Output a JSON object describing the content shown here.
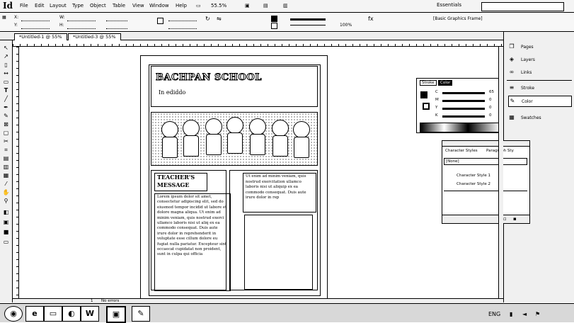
{
  "app": {
    "logo": "Id"
  },
  "menu": {
    "items": [
      "File",
      "Edit",
      "Layout",
      "Type",
      "Object",
      "Table",
      "View",
      "Window",
      "Help"
    ],
    "zoom": "55.5%",
    "workspace": "Essentials"
  },
  "control": {
    "frame_style": "[Basic Graphics Frame]",
    "scale": "100%",
    "x_label": "X:",
    "y_label": "Y:",
    "w_label": "W:",
    "h_label": "H:"
  },
  "tabs": [
    {
      "label": "*Untitled-1 @ 55%"
    },
    {
      "label": "*Untitled-3 @ 55%"
    }
  ],
  "document": {
    "school_title": "BACHPAN SCHOOL",
    "school_subtitle": "In ediddo",
    "teacher_title": "TEACHER'S MESSAGE",
    "teacher_text": "Lorem ipsum dolor sit amet, consectetur adipiscing elit, sed do eiusmod tempor incidid ut labore et dolore magna aliqua. Ut enim ad minim veniam, quis nostrud exerci ullamco laboris nisi ut aliq ex ea commodo consequat. Duis aute irure dolor in reprehenderit in voluptate esse cillum dolore eu fugiat nulla pariatur. Excepteur sint occaecat cupidatat non proident, sunt in culpa qui officia",
    "right_text": "Ut enim ad minim veniam, quis nostrud exercitation ullamco laboris nisi ut aliquip ex ea commodo consequat. Duis aute irure dolor in rep"
  },
  "panels": {
    "items": [
      {
        "label": "Pages",
        "icon": "pages-icon",
        "glyph": "❐"
      },
      {
        "label": "Layers",
        "icon": "layers-icon",
        "glyph": "◈"
      },
      {
        "label": "Links",
        "icon": "links-icon",
        "glyph": "∞"
      },
      {
        "label": "Stroke",
        "icon": "stroke-icon",
        "glyph": "≡"
      },
      {
        "label": "Color",
        "icon": "color-icon",
        "glyph": "✎"
      },
      {
        "label": "Swatches",
        "icon": "swatches-icon",
        "glyph": "▦"
      }
    ],
    "color_panel": {
      "tabs": [
        "Stroke",
        "Color"
      ],
      "rows": [
        {
          "label": "C",
          "value": "65"
        },
        {
          "label": "M",
          "value": "0"
        },
        {
          "label": "Y",
          "value": "0"
        },
        {
          "label": "K",
          "value": "0"
        }
      ]
    },
    "char_panel": {
      "tabs": [
        "Character Styles",
        "Paragraph Sty"
      ],
      "items": [
        "[None]",
        "Character Style 1",
        "Character Style 2"
      ]
    }
  },
  "statusbar": {
    "page": "1",
    "status": "No errors"
  },
  "taskbar": {
    "items": [
      "ie-icon",
      "explorer-icon",
      "media-icon",
      "word-icon",
      "indesign-icon",
      "paint-icon"
    ],
    "tray_text": "ENG"
  }
}
